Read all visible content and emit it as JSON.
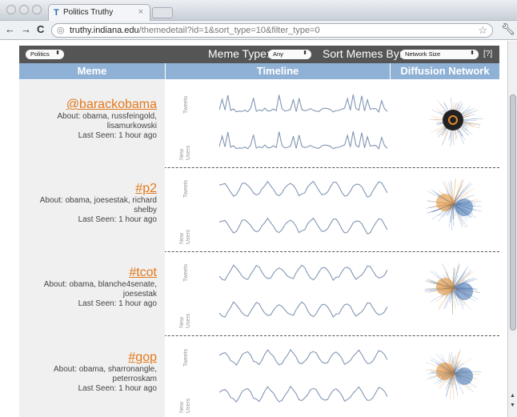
{
  "browser": {
    "tab_title": "Politics Truthy",
    "url_domain": "truthy.indiana.edu",
    "url_path": "/themedetail?id=1&sort_type=10&filter_type=0"
  },
  "controls": {
    "category_value": "Politics",
    "meme_type_label": "Meme Type:",
    "meme_type_value": "Any",
    "sort_label": "Sort Memes By:",
    "sort_value": "Network Size",
    "help_label": "[?]"
  },
  "table": {
    "headers": [
      "Meme",
      "Timeline",
      "Diffusion Network"
    ],
    "axis_labels": {
      "tweets": "Tweets",
      "new_users": "New Users"
    },
    "rows": [
      {
        "name": "@barackobama",
        "about": "About: obama, russfeingold, lisamurkowski",
        "seen": "Last Seen: 1 hour ago"
      },
      {
        "name": "#p2",
        "about": "About: obama, joesestak, richard shelby",
        "seen": "Last Seen: 1 hour ago"
      },
      {
        "name": "#tcot",
        "about": "About: obama, blanche4senate, joesestak",
        "seen": "Last Seen: 1 hour ago"
      },
      {
        "name": "#gop",
        "about": "About: obama, sharronangle, peterroskam",
        "seen": "Last Seen: 1 hour ago"
      }
    ]
  },
  "colors": {
    "accent": "#e3781b",
    "header": "#8fb1d6",
    "controls_bar": "#555555",
    "sparkline": "#8297b4",
    "network_blue": "#3c6fb0",
    "network_orange": "#e08a2c"
  }
}
